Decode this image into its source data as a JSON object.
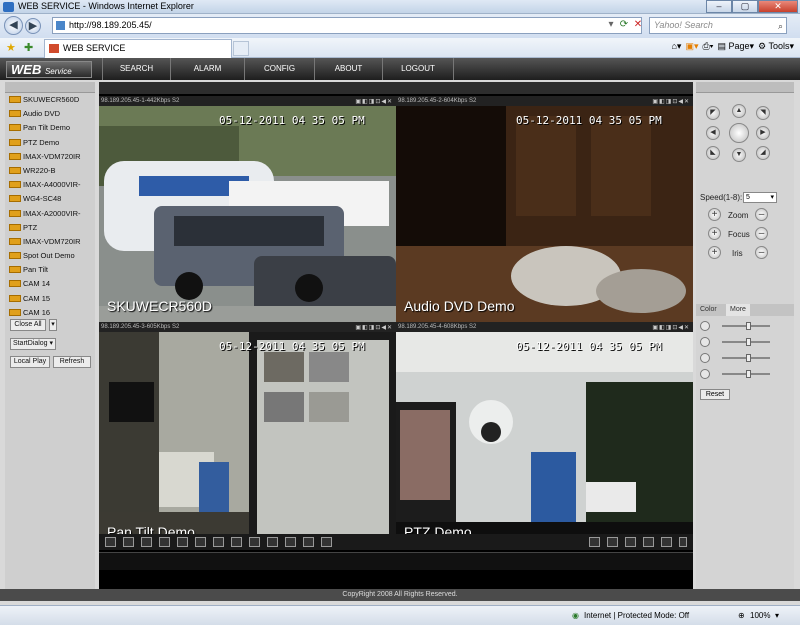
{
  "window": {
    "title": "WEB SERVICE - Windows Internet Explorer"
  },
  "browser": {
    "url": "http://98.189.205.45/",
    "search_placeholder": "Yahoo! Search",
    "tab_title": "WEB SERVICE",
    "cmd_page": "Page",
    "cmd_tools": "Tools"
  },
  "app": {
    "logo_main": "WEB",
    "logo_sub": "Service",
    "menu": [
      "SEARCH",
      "ALARM",
      "CONFIG",
      "ABOUT",
      "LOGOUT"
    ]
  },
  "devices": [
    "SKUWECR560D",
    "Audio DVD",
    "Pan Tilt Demo",
    "PTZ Demo",
    "IMAX-VDM720IR",
    "WR220-B",
    "IMAX-A4000VIR-",
    "WG4-SC48",
    "IMAX-A2000VIR-",
    "PTZ",
    "IMAX-VDM720IR",
    "Spot Out Demo",
    "Pan Tilt",
    "CAM 14",
    "CAM 15",
    "CAM 16"
  ],
  "left_buttons": {
    "close_all": "Close All",
    "start_dialog": "StartDialog",
    "local_play": "Local Play",
    "refresh": "Refresh"
  },
  "tiles": [
    {
      "header": "98.189.205.45-1-442Kbps S2",
      "timestamp": "05-12-2011 04 35 05 PM",
      "label": "SKUWECR560D"
    },
    {
      "header": "98.189.205.45-2-604Kbps S2",
      "timestamp": "05-12-2011 04 35 05 PM",
      "label": "Audio DVD Demo"
    },
    {
      "header": "98.189.205.45-3-605Kbps S2",
      "timestamp": "05-12-2011 04 35 05 PM",
      "label": "Pan Tilt Demo"
    },
    {
      "header": "98.189.205.45-4-608Kbps S2",
      "timestamp": "05-12-2011 04 35 05 PM",
      "label": "PTZ Demo"
    }
  ],
  "ptz": {
    "speed_label": "Speed(1-8):",
    "speed_value": "5",
    "zoom": "Zoom",
    "focus": "Focus",
    "iris": "Iris"
  },
  "color_panel": {
    "tab_color": "Color",
    "tab_more": "More",
    "reset": "Reset"
  },
  "footer": {
    "copyright": "CopyRight 2008 All Rights Reserved."
  },
  "statusbar": {
    "zone": "Internet | Protected Mode: Off",
    "zoom": "100%"
  }
}
